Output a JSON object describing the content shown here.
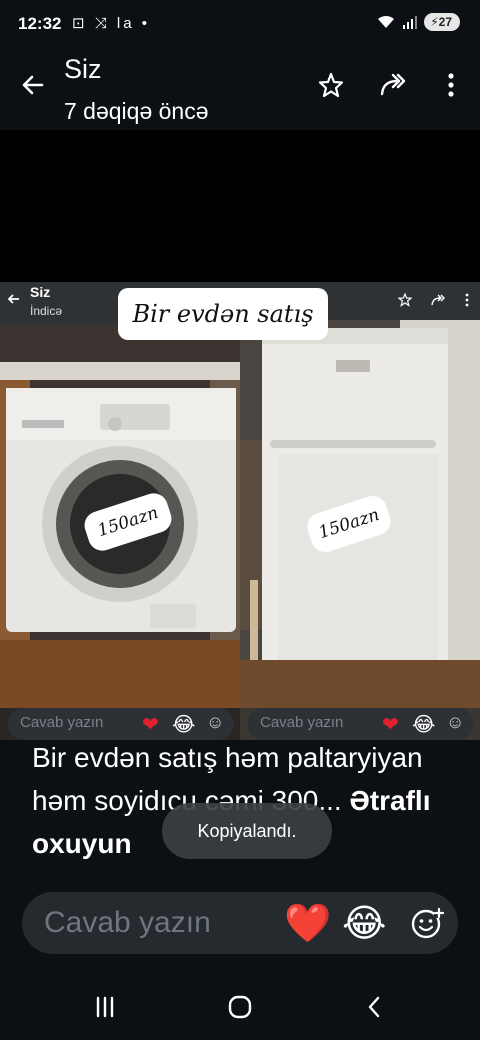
{
  "status_bar": {
    "time": "12:32",
    "left_icons": "⊡ ⤨ la •",
    "battery": "27",
    "icons": [
      "screen-record-icon",
      "shuffle-icon",
      "la-icon",
      "dot-icon",
      "wifi-icon",
      "signal-icon",
      "battery-icon"
    ]
  },
  "header": {
    "title": "Siz",
    "subtitle": "7 dəqiqə öncə",
    "icons": [
      "back-arrow-icon",
      "star-icon",
      "forward-icon",
      "more-vertical-icon"
    ]
  },
  "media": {
    "mini_header_title": "Siz",
    "mini_header_sub": "İndicə",
    "overlay_label": "Bir evdən satış",
    "left_price": "150azn",
    "right_price": "150azn",
    "mini_reply_placeholder": "Cavab yazın"
  },
  "caption": {
    "text": "Bir evdən satış  həm paltaryiyan həm soyidıcu cəmi 300...",
    "more": "Ətraflı oxuyun"
  },
  "toast": {
    "text": "Kopiyalandı."
  },
  "reply": {
    "placeholder": "Cavab yazın",
    "emojis": [
      "❤️",
      "😂"
    ],
    "icons": [
      "add-emoji-icon"
    ]
  },
  "nav": {
    "icons": [
      "recent-apps-icon",
      "home-icon",
      "back-icon"
    ]
  },
  "colors": {
    "background": "#0c1014",
    "reply_bar": "#252a2f",
    "heart": "#e3202b"
  }
}
